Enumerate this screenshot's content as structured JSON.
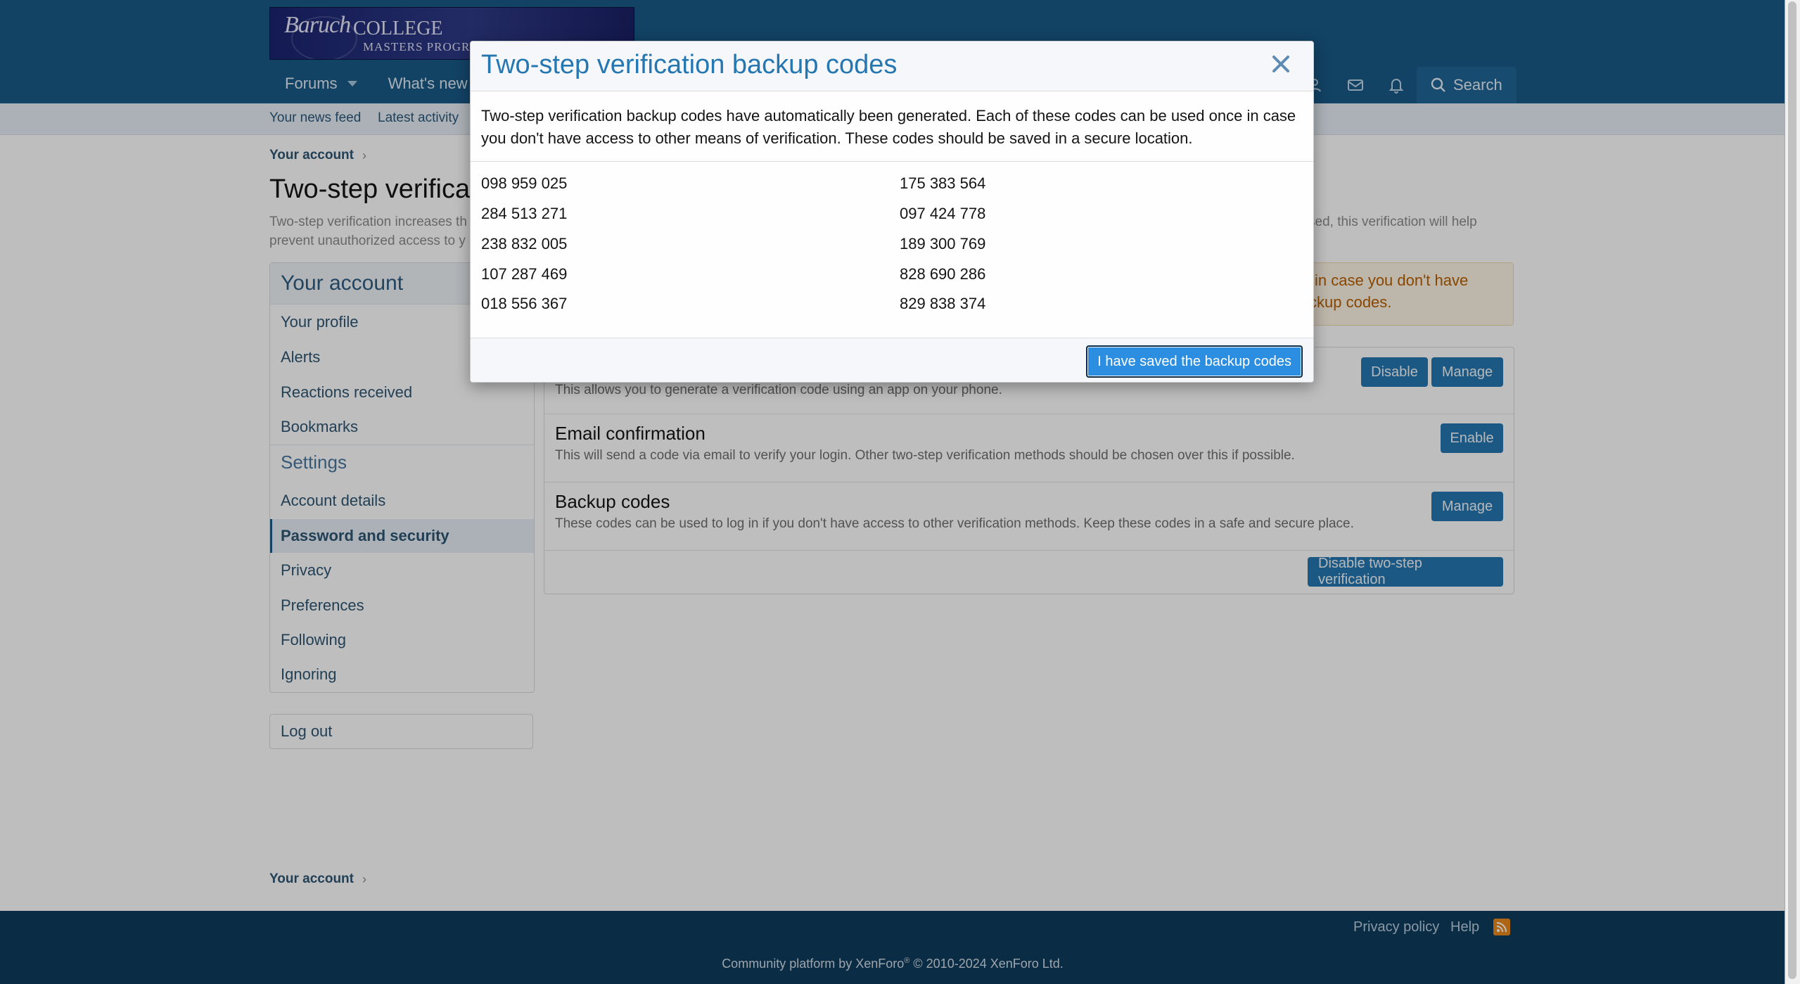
{
  "header": {
    "logo": {
      "script": "Baruch",
      "college": "COLLEGE",
      "masters": "MASTERS PROGRAM"
    },
    "nav_tabs": [
      {
        "label": "Forums",
        "has_caret": true
      },
      {
        "label": "What's new",
        "has_caret": false
      }
    ],
    "icons": [
      "user-icon",
      "envelope-icon",
      "bell-icon"
    ],
    "search_label": "Search"
  },
  "subnav": {
    "items": [
      "Your news feed",
      "Latest activity"
    ]
  },
  "breadcrumb": {
    "label": "Your account"
  },
  "page": {
    "title": "Two-step verificati",
    "description_left_line1": "Two-step verification increases th",
    "description_left_line2": "prevent unauthorized access to y",
    "description_right": "sed, this verification will help"
  },
  "sidebar": {
    "heading": "Your account",
    "items": [
      "Your profile",
      "Alerts",
      "Reactions received",
      "Bookmarks"
    ],
    "settings_heading": "Settings",
    "settings_items": [
      "Account details",
      "Password and security",
      "Privacy",
      "Preferences",
      "Following",
      "Ignoring"
    ],
    "active_item": "Password and security",
    "logout": "Log out"
  },
  "notice": {
    "line1": "in case you don't have",
    "line2": "ckup codes."
  },
  "methods": {
    "app": {
      "desc": "This allows you to generate a verification code using an app on your phone.",
      "disable_label": "Disable",
      "manage_label": "Manage"
    },
    "email": {
      "title": "Email confirmation",
      "desc": "This will send a code via email to verify your login. Other two-step verification methods should be chosen over this if possible.",
      "enable_label": "Enable"
    },
    "backup": {
      "title": "Backup codes",
      "desc": "These codes can be used to log in if you don't have access to other verification methods. Keep these codes in a safe and secure place.",
      "manage_label": "Manage"
    },
    "disable_all_label": "Disable two-step verification"
  },
  "footer": {
    "breadcrumb": "Your account",
    "links": [
      "Privacy policy",
      "Help"
    ],
    "rss_icon": "rss-icon",
    "copyright_prefix": "Community platform by XenForo",
    "copyright_sup": "®",
    "copyright_suffix": " © 2010-2024 XenForo Ltd."
  },
  "modal": {
    "title": "Two-step verification backup codes",
    "close_icon": "close-icon",
    "description": "Two-step verification backup codes have automatically been generated. Each of these codes can be used once in case you don't have access to other means of verification. These codes should be saved in a secure location.",
    "codes_left": [
      "098 959 025",
      "284 513 271",
      "238 832 005",
      "107 287 469",
      "018 556 367"
    ],
    "codes_right": [
      "175 383 564",
      "097 424 778",
      "189 300 769",
      "828 690 286",
      "829 838 374"
    ],
    "confirm_label": "I have saved the backup codes"
  },
  "colors": {
    "header": "#185886",
    "accent": "#2577b1",
    "notice_text": "#b75e00",
    "footer": "#0f3b5c"
  }
}
